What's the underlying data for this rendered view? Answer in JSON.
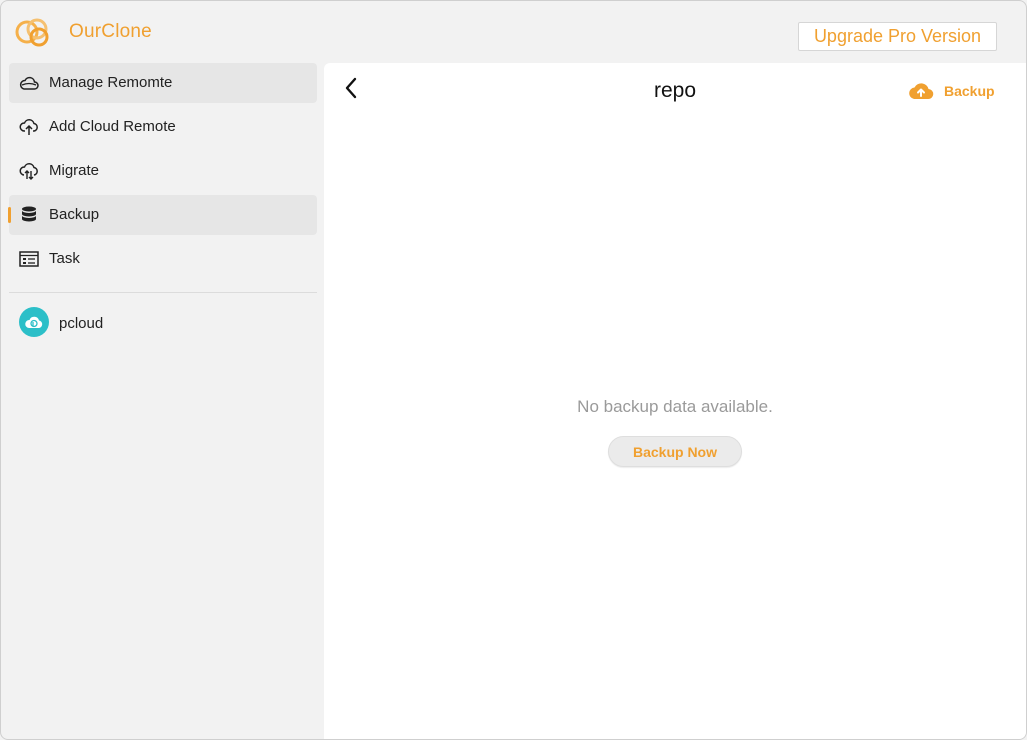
{
  "app": {
    "name": "OurClone",
    "brand_color": "#f0a030",
    "logo_icon": "ourclone-logo-icon"
  },
  "header": {
    "upgrade_label": "Upgrade Pro Version"
  },
  "sidebar": {
    "items": [
      {
        "label": "Manage Remomte",
        "icon": "cloud-outline-icon",
        "state": "hover"
      },
      {
        "label": "Add Cloud Remote",
        "icon": "cloud-upload-icon",
        "state": "normal"
      },
      {
        "label": "Migrate",
        "icon": "cloud-transfer-icon",
        "state": "normal"
      },
      {
        "label": "Backup",
        "icon": "database-icon",
        "state": "active"
      },
      {
        "label": "Task",
        "icon": "task-list-icon",
        "state": "normal"
      }
    ],
    "remotes": [
      {
        "label": "pcloud",
        "icon": "pcloud-icon",
        "color": "#2cbfc8"
      }
    ]
  },
  "main": {
    "title": "repo",
    "back_icon": "chevron-left-icon",
    "backup_action": {
      "label": "Backup",
      "icon": "cloud-upload-filled-icon"
    },
    "empty_message": "No backup data available.",
    "backup_now_label": "Backup Now"
  }
}
